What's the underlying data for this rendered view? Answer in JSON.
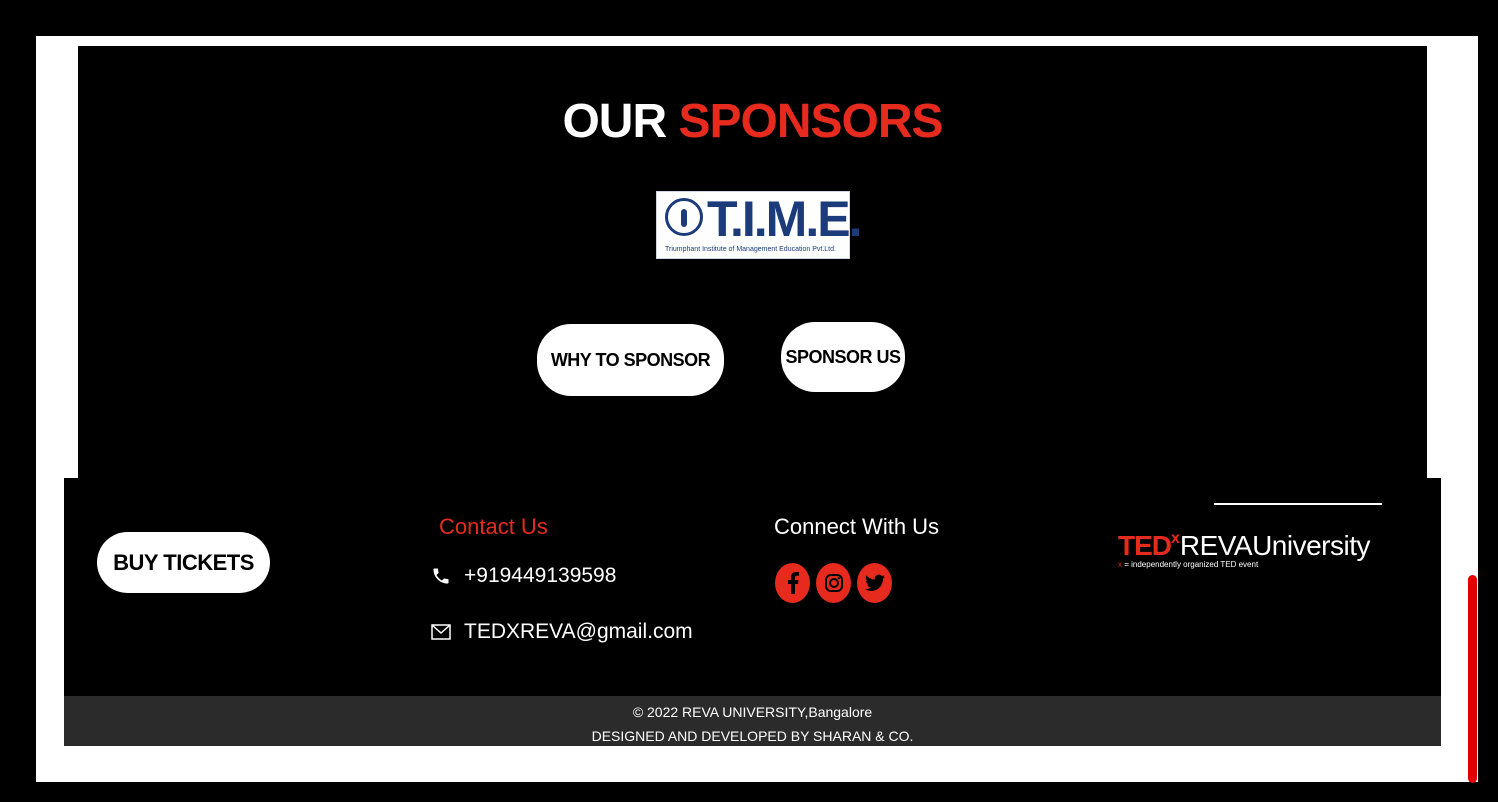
{
  "sponsors": {
    "heading_white": "OUR",
    "heading_red": "SPONSORS",
    "logo": {
      "brand": "T.I.M.E.",
      "tagline": "Triumphant Institute of Management Education Pvt.Ltd."
    },
    "why_button": "WHY TO SPONSOR",
    "sponsor_button": "SPONSOR US"
  },
  "footer": {
    "buy_button": "BUY TICKETS",
    "contact_title": "Contact Us",
    "phone": "+919449139598",
    "email": "TEDXREVA@gmail.com",
    "connect_title": "Connect With Us",
    "socials": [
      "facebook-icon",
      "instagram-icon",
      "twitter-icon"
    ],
    "ted_logo": {
      "ted": "TED",
      "x": "x",
      "name": "REVAUniversity",
      "sub_x": "x",
      "sub": " = independently organized TED event"
    },
    "copyright": "© 2022 REVA UNIVERSITY,Bangalore",
    "credits": "DESIGNED AND DEVELOPED BY SHARAN & CO."
  },
  "colors": {
    "accent": "#e62b1e",
    "background": "#000000",
    "bottom_bar": "#2b2b2b"
  }
}
